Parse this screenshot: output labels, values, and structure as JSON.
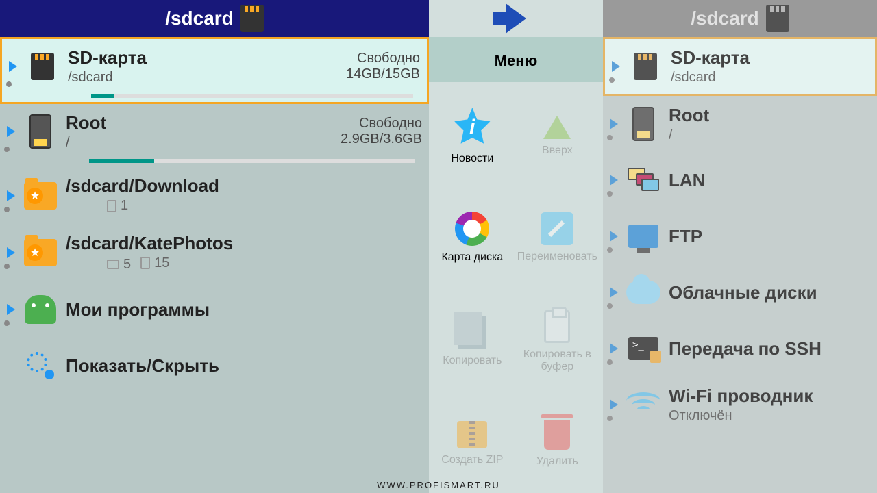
{
  "leftPanel": {
    "headerPath": "/sdcard",
    "items": [
      {
        "title": "SD-карта",
        "sub": "/sdcard",
        "freeLabel": "Свободно",
        "free": "14GB/15GB",
        "fillPct": 7,
        "icon": "sd",
        "selected": true,
        "showBar": true
      },
      {
        "title": "Root",
        "sub": "/",
        "freeLabel": "Свободно",
        "free": "2.9GB/3.6GB",
        "fillPct": 20,
        "icon": "phone",
        "showBar": true
      },
      {
        "title": "/sdcard/Download",
        "files": "1",
        "icon": "folder-star"
      },
      {
        "title": "/sdcard/KatePhotos",
        "folders": "5",
        "files": "15",
        "icon": "folder-star"
      },
      {
        "title": "Мои программы",
        "icon": "android"
      },
      {
        "title": "Показать/Скрыть",
        "icon": "circles",
        "noCaret": true
      }
    ]
  },
  "menu": {
    "title": "Меню",
    "cells": [
      {
        "label": "Новости",
        "icon": "news",
        "enabled": true
      },
      {
        "label": "Вверх",
        "icon": "up",
        "enabled": false
      },
      {
        "label": "Карта диска",
        "icon": "disk",
        "enabled": true
      },
      {
        "label": "Переименовать",
        "icon": "rename",
        "enabled": false
      },
      {
        "label": "Копировать",
        "icon": "copy",
        "enabled": false
      },
      {
        "label": "Копировать в буфер",
        "icon": "clip",
        "enabled": false
      },
      {
        "label": "Создать ZIP",
        "icon": "zip",
        "enabled": false
      },
      {
        "label": "Удалить",
        "icon": "trash",
        "enabled": false
      }
    ]
  },
  "rightPanel": {
    "headerPath": "/sdcard",
    "items": [
      {
        "title": "SD-карта",
        "sub": "/sdcard",
        "icon": "sd",
        "selected": true
      },
      {
        "title": "Root",
        "sub": "/",
        "icon": "phone"
      },
      {
        "title": "LAN",
        "icon": "lan"
      },
      {
        "title": "FTP",
        "icon": "ftp"
      },
      {
        "title": "Облачные диски",
        "icon": "cloud"
      },
      {
        "title": "Передача по SSH",
        "icon": "ssh"
      },
      {
        "title": "Wi-Fi проводник",
        "sub": "Отключён",
        "icon": "wifi"
      }
    ]
  },
  "watermark": "WWW.PROFISMART.RU"
}
